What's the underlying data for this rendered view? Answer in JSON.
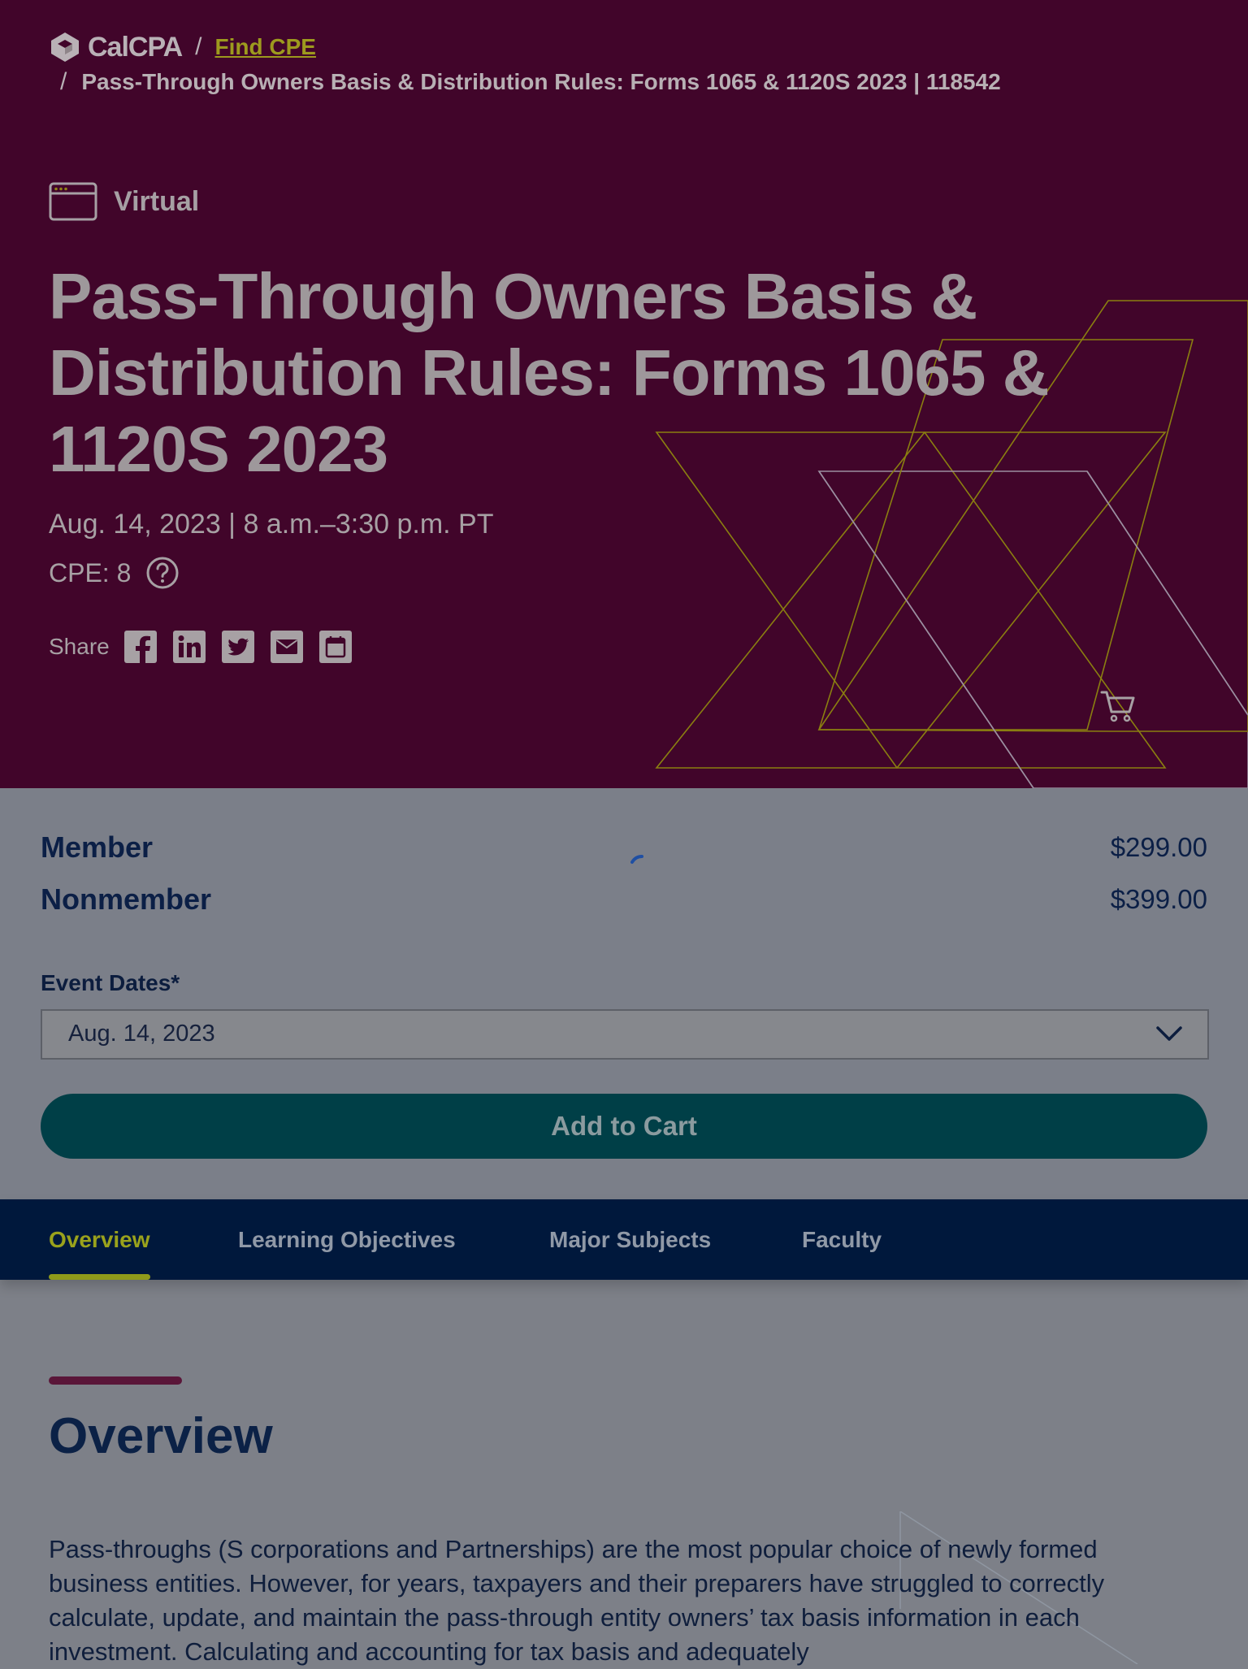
{
  "breadcrumb": {
    "logo_text": "CalCPA",
    "separator": "/",
    "link": "Find CPE",
    "current": "Pass-Through Owners Basis & Distribution Rules: Forms 1065 & 1120S 2023 | 118542"
  },
  "event": {
    "format": "Virtual",
    "title": "Pass-Through Owners Basis & Distribution Rules: Forms 1065 & 1120S 2023",
    "when": "Aug. 14, 2023 | 8 a.m.–3:30 p.m. PT",
    "cpe": "CPE: 8"
  },
  "share": {
    "label": "Share",
    "icons": [
      "facebook-icon",
      "linkedin-icon",
      "twitter-icon",
      "email-icon",
      "calendar-icon"
    ]
  },
  "pricing": [
    {
      "name": "Member",
      "price": "$299.00"
    },
    {
      "name": "Nonmember",
      "price": "$399.00"
    }
  ],
  "event_dates": {
    "label": "Event Dates*",
    "selected": "Aug. 14, 2023"
  },
  "add_to_cart": "Add to Cart",
  "tabs": [
    {
      "label": "Overview",
      "active": true
    },
    {
      "label": "Learning Objectives",
      "active": false
    },
    {
      "label": "Major Subjects",
      "active": false
    },
    {
      "label": "Faculty",
      "active": false
    }
  ],
  "overview": {
    "heading": "Overview",
    "body": "Pass-throughs (S corporations and Partnerships) are the most popular choice of newly formed business entities. However, for years, taxpayers and their preparers have struggled to correctly calculate, update, and maintain the pass-through entity owners’ tax basis information in each investment. Calculating and accounting for tax basis and adequately"
  },
  "colors": {
    "hero_bg": "#41052a",
    "accent_lime": "#9aa21c",
    "nav_bg": "#00183c",
    "button_bg": "#003f47"
  }
}
